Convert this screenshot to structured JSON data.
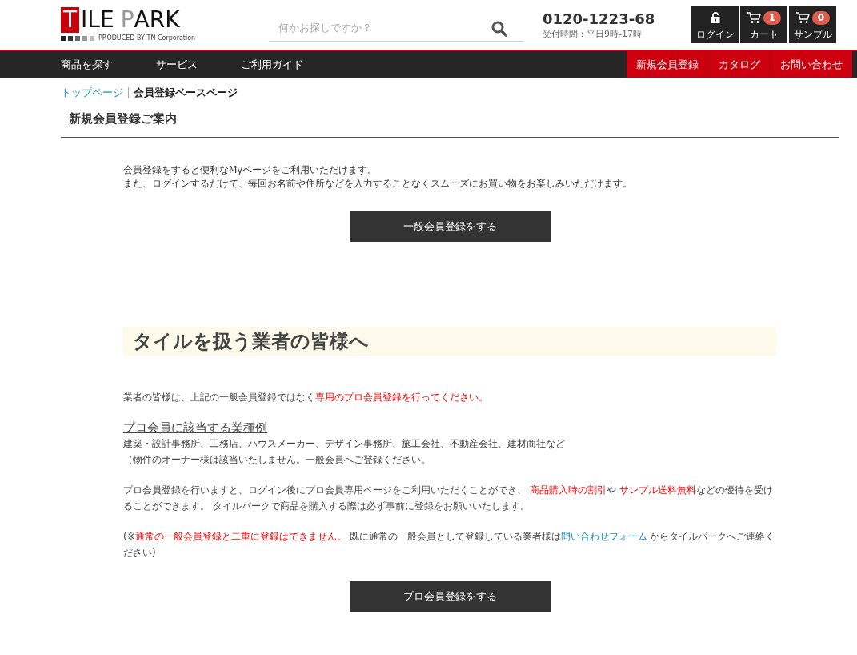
{
  "logo": {
    "words": [
      {
        "letters": [
          {
            "kind": "boxed",
            "text": "T"
          },
          {
            "kind": "plain",
            "text": "ILE"
          }
        ]
      },
      {
        "letters": [
          {
            "kind": "gray",
            "text": "P"
          },
          {
            "kind": "plain",
            "text": "ARK"
          }
        ]
      }
    ],
    "tagline": "PRODUCED BY TN Corporation"
  },
  "search": {
    "placeholder": "何かお探しですか？"
  },
  "contact": {
    "phone": "0120-1223-68",
    "hours": "受付時間：平日9時-17時"
  },
  "header_buttons": [
    {
      "kind": "login",
      "label": "ログイン"
    },
    {
      "kind": "cart",
      "label": "カート",
      "count": "1"
    },
    {
      "kind": "cart",
      "label": "サンプル",
      "count": "0"
    }
  ],
  "nav": {
    "left": [
      "商品を探す",
      "サービス",
      "ご利用ガイド"
    ],
    "right": [
      "新規会員登録",
      "カタログ",
      "お問い合わせ"
    ]
  },
  "breadcrumb": [
    {
      "label": "トップページ",
      "kind": "link"
    },
    {
      "label": "会員登録ベースページ",
      "kind": "current"
    }
  ],
  "page_title": "新規会員登録ご案内",
  "intro": [
    "会員登録をすると便利なMyページをご利用いただけます。",
    "また、ログインするだけで、毎回お名前や住所などを入力することなくスムーズにお買い物をお楽しみいただけます。"
  ],
  "general_button": "一般会員登録をする",
  "pro_heading": "タイルを扱う業者の皆様へ",
  "pro_paragraphs": [
    [
      {
        "kind": "normal",
        "text": "業者の皆様は、上記の一般会員登録ではなく"
      },
      {
        "kind": "emphasis",
        "text": "専用のプロ会員登録を行ってください。"
      }
    ],
    [
      {
        "kind": "heading",
        "text": "プロ会員に該当する業種例"
      }
    ],
    [
      {
        "kind": "normal",
        "text": "建築・設計事務所、工務店、ハウスメーカー、デザイン事務所、施工会社、不動産会社、建材商社など"
      }
    ],
    [
      {
        "kind": "normal",
        "text": "（物件のオーナー様は該当いたしません。一般会員へご登録ください。"
      }
    ],
    [
      {
        "kind": "normal",
        "text": "プロ会員登録を行いますと、ログイン後にプロ会員専用ページをご利用いただくことができ、 "
      },
      {
        "kind": "emphasis",
        "text": "商品購入時の割引"
      },
      {
        "kind": "normal",
        "text": "や "
      },
      {
        "kind": "emphasis",
        "text": "サンプル送料無料"
      },
      {
        "kind": "normal",
        "text": "などの優待を受けることができます。 タイルパークで商品を購入する際は必ず事前に登録をお願いいたします。"
      }
    ],
    [
      {
        "kind": "normal",
        "text": "(※"
      },
      {
        "kind": "emphasis",
        "text": "通常の一般会員登録と二重に登録はできません。"
      },
      {
        "kind": "normal",
        "text": " 既に通常の一般会員として登録している業者様は"
      },
      {
        "kind": "link",
        "text": "問い合わせフォーム"
      },
      {
        "kind": "normal",
        "text": " からタイルパークへご連絡ください)"
      }
    ]
  ],
  "pro_button": "プロ会員登録をする"
}
